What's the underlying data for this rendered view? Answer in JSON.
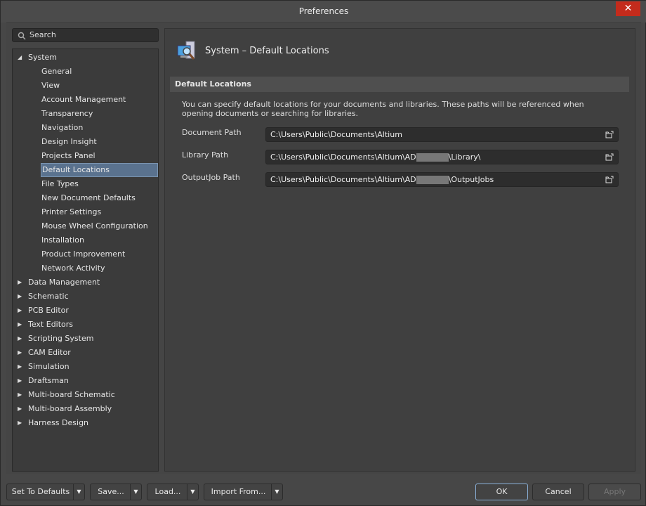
{
  "window": {
    "title": "Preferences",
    "close": "✕"
  },
  "search": {
    "placeholder": "Search"
  },
  "tree": {
    "system": "System",
    "system_children": [
      "General",
      "View",
      "Account Management",
      "Transparency",
      "Navigation",
      "Design Insight",
      "Projects Panel",
      "Default Locations",
      "File Types",
      "New Document Defaults",
      "Printer Settings",
      "Mouse Wheel Configuration",
      "Installation",
      "Product Improvement",
      "Network Activity"
    ],
    "selected": "Default Locations",
    "others": [
      "Data Management",
      "Schematic",
      "PCB Editor",
      "Text Editors",
      "Scripting System",
      "CAM Editor",
      "Simulation",
      "Draftsman",
      "Multi-board Schematic",
      "Multi-board Assembly",
      "Harness Design"
    ]
  },
  "page": {
    "title": "System – Default Locations",
    "section": "Default Locations",
    "description": "You can specify default locations for your documents and libraries. These paths will be referenced when opening documents or searching for libraries.",
    "fields": [
      {
        "label": "Document Path",
        "prefix": "C:\\Users\\Public\\Documents\\Altium",
        "suffix": ""
      },
      {
        "label": "Library Path",
        "prefix": "C:\\Users\\Public\\Documents\\Altium\\AD",
        "suffix": "\\Library\\"
      },
      {
        "label": "OutputJob Path",
        "prefix": "C:\\Users\\Public\\Documents\\Altium\\AD",
        "suffix": "\\OutputJobs"
      }
    ]
  },
  "buttons": {
    "defaults": "Set To Defaults",
    "save": "Save...",
    "load": "Load...",
    "import": "Import From...",
    "ok": "OK",
    "cancel": "Cancel",
    "apply": "Apply"
  }
}
